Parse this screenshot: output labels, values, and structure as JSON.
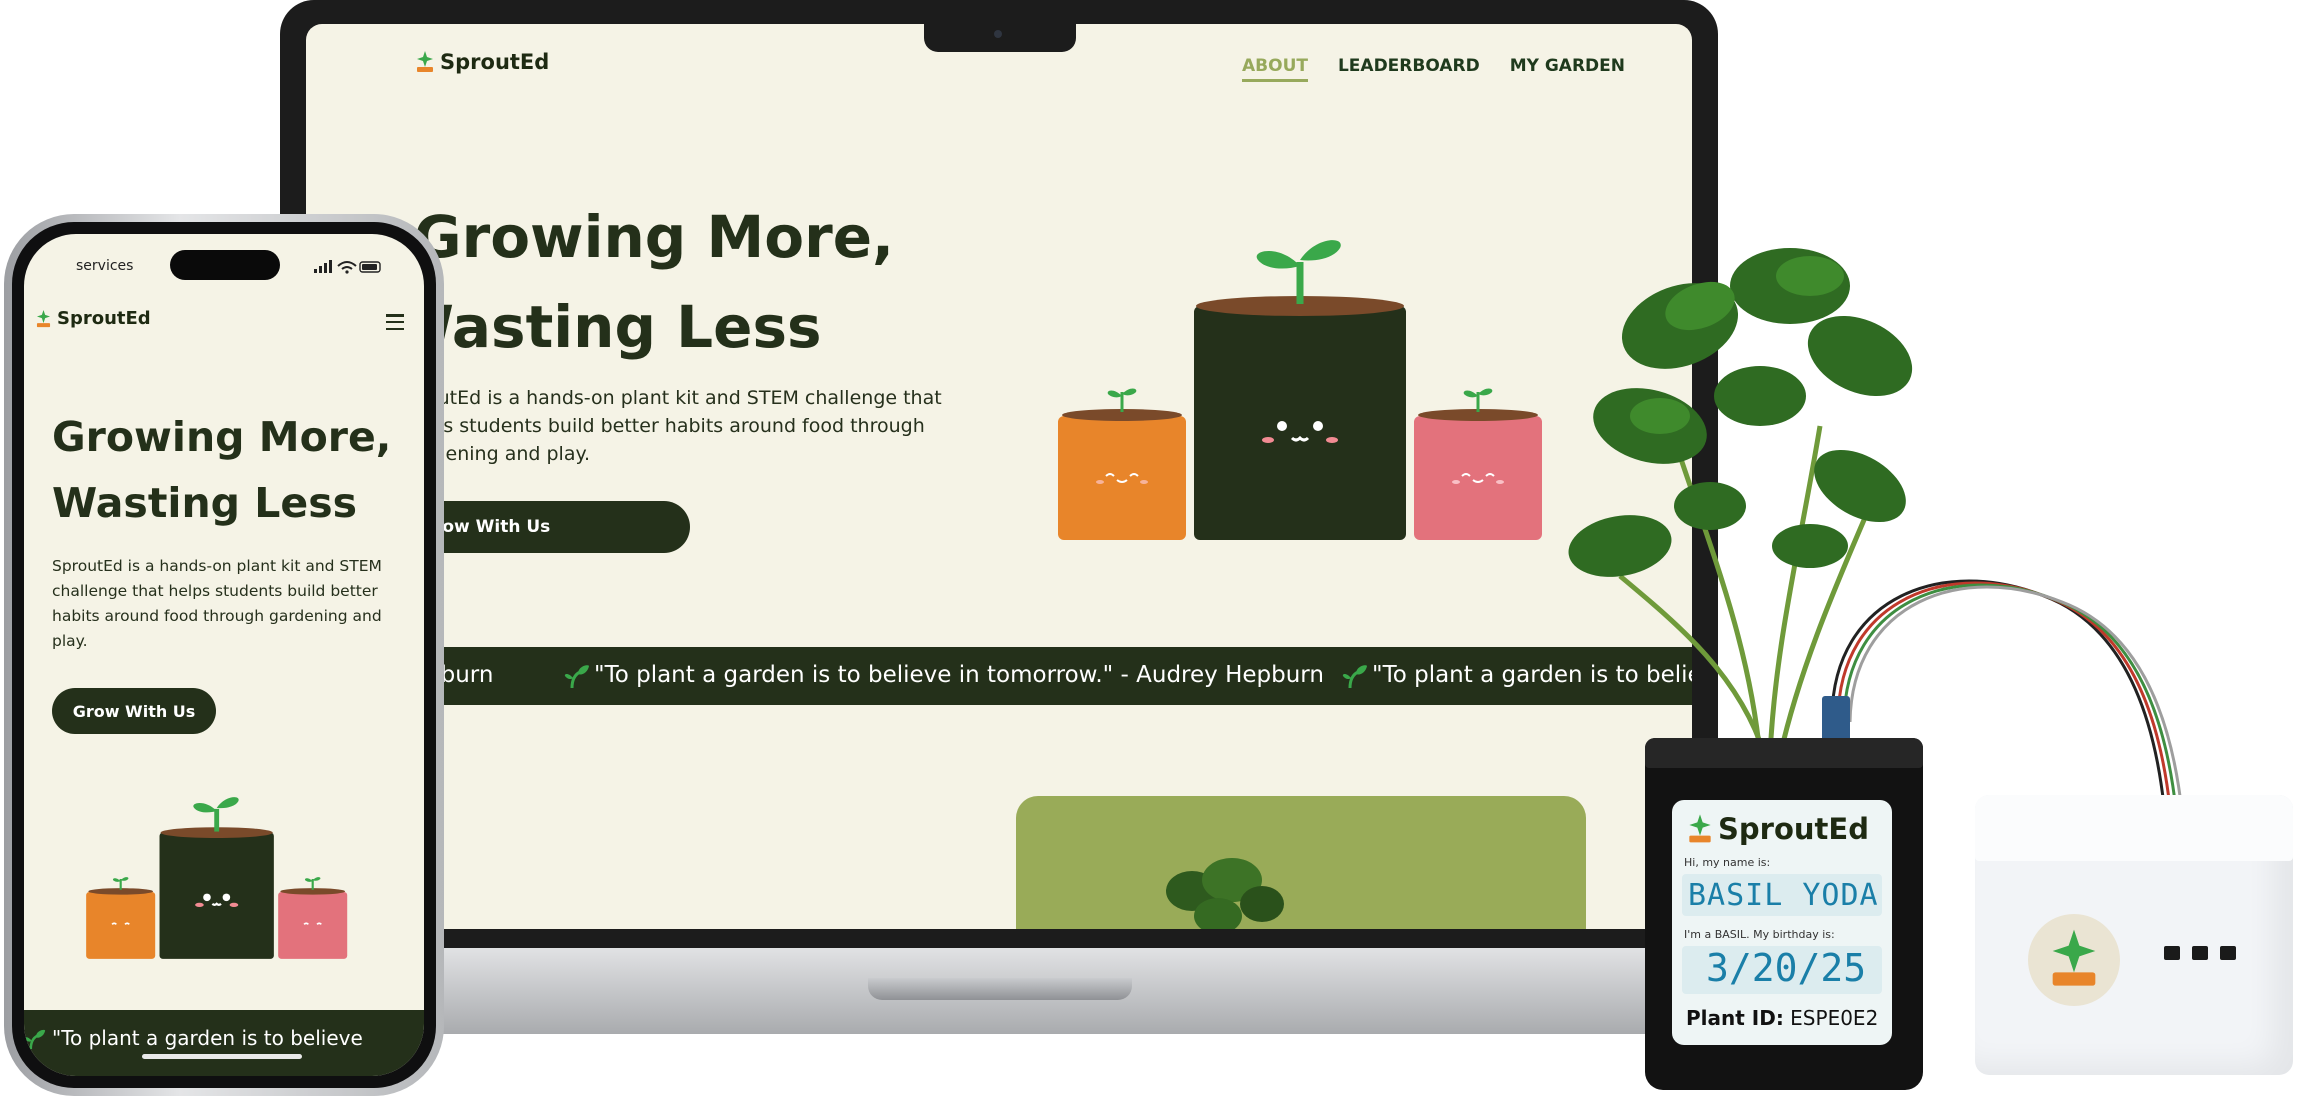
{
  "laptop": {
    "brand": "SproutEd",
    "nav": [
      "ABOUT",
      "LEADERBOARD",
      "MY GARDEN"
    ],
    "hero_line1": "Growing More,",
    "hero_line2": "Wasting Less",
    "hero_body_line1": "outEd is a hands-on plant kit and STEM challenge that",
    "hero_body_line2": "lps students build better habits around food through",
    "hero_body_line3": "rdening and play.",
    "cta": "Grow With Us",
    "ticker_left": "pburn",
    "ticker_middle": "\"To plant a garden is to believe in tomorrow.\" - Audrey Hepburn",
    "ticker_right": "\"To plant a garden is to believ"
  },
  "phone": {
    "status_text": "services",
    "brand": "SproutEd",
    "hero_line1": "Growing More,",
    "hero_line2": "Wasting Less",
    "hero_body_line1": "SproutEd is a hands-on plant kit and STEM",
    "hero_body_line2": "challenge that helps students build better",
    "hero_body_line3": "habits around food through gardening and",
    "hero_body_line4": "play.",
    "cta": "Grow With Us",
    "ticker": "\"To plant a garden is to believe"
  },
  "plant_label": {
    "brand": "SproutEd",
    "name_prompt": "Hi, my name is:",
    "name": "BASIL YODA",
    "birthday_prompt": "I'm a BASIL. My birthday is:",
    "birthday": "3/20/25",
    "id_label": "Plant ID:",
    "id_value": "ESPE0E2"
  },
  "colors": {
    "dark_green": "#24301a",
    "olive": "#97a95c",
    "cream": "#f5f3e6",
    "orange": "#e8852a",
    "pink": "#e3727c",
    "leaf": "#3aa84a"
  }
}
